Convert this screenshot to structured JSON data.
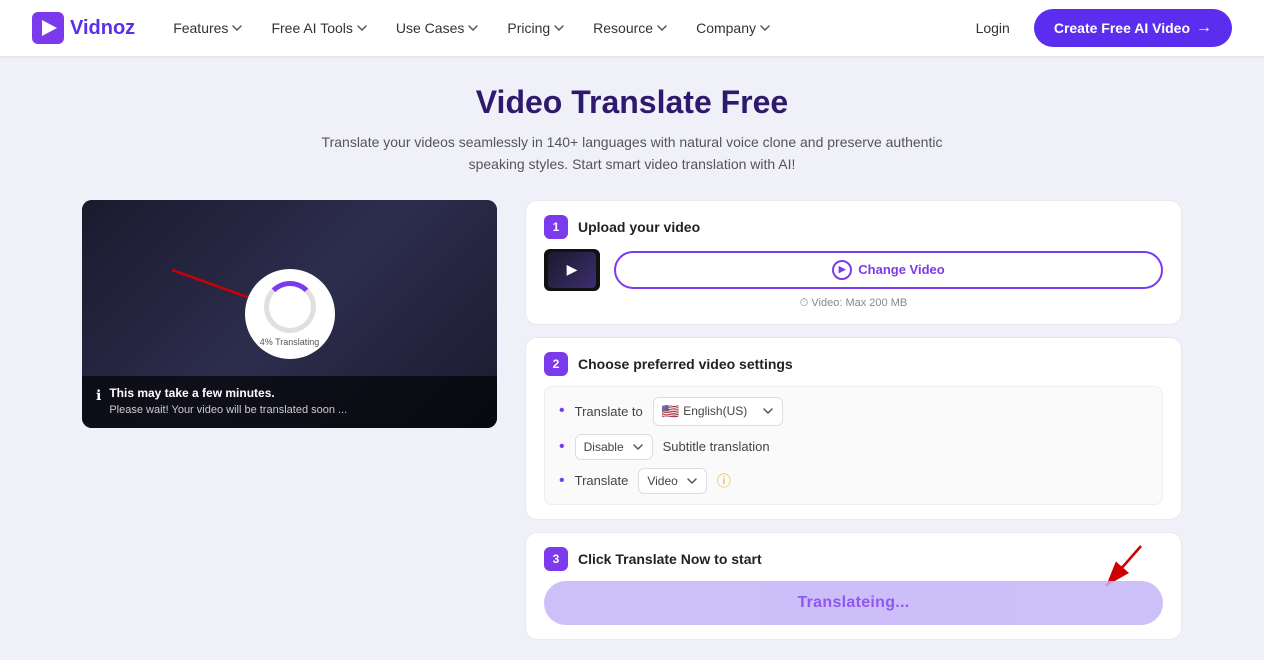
{
  "navbar": {
    "logo_text": "Vidnoz",
    "nav_items": [
      {
        "label": "Features",
        "has_chevron": true
      },
      {
        "label": "Free AI Tools",
        "has_chevron": true
      },
      {
        "label": "Use Cases",
        "has_chevron": true
      },
      {
        "label": "Pricing",
        "has_chevron": true
      },
      {
        "label": "Resource",
        "has_chevron": true
      },
      {
        "label": "Company",
        "has_chevron": true
      }
    ],
    "login_label": "Login",
    "cta_label": "Create Free AI Video"
  },
  "hero": {
    "title": "Video Translate Free",
    "subtitle": "Translate your videos seamlessly in 140+ languages with natural voice clone and preserve authentic speaking styles. Start smart video translation with AI!"
  },
  "video_panel": {
    "progress_text": "4% Translating",
    "notice_bold": "This may take a few minutes.",
    "notice_sub": "Please wait! Your video will be translated soon ..."
  },
  "step1": {
    "badge": "1",
    "title": "Upload your video",
    "change_video_label": "Change Video",
    "max_note": "⏱ Video: Max 200 MB"
  },
  "step2": {
    "badge": "2",
    "title": "Choose preferred video settings",
    "translate_to_label": "Translate to",
    "language_value": "English(US)",
    "subtitle_label": "Subtitle translation",
    "disable_label": "Disable",
    "translate_label": "Translate",
    "video_label": "Video"
  },
  "step3": {
    "badge": "3",
    "title": "Click Translate Now to start",
    "button_label": "Translateing..."
  }
}
